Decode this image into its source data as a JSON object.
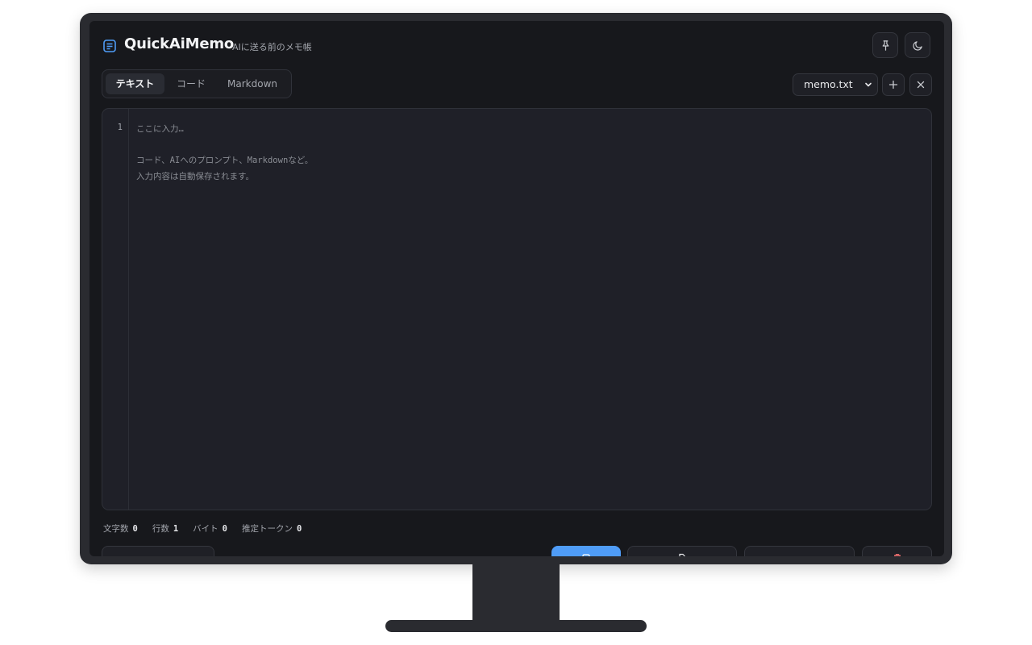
{
  "app": {
    "title": "QuickAiMemo",
    "subtitle": "AIに送る前のメモ帳"
  },
  "tabs": [
    {
      "label": "テキスト",
      "active": true
    },
    {
      "label": "コード",
      "active": false
    },
    {
      "label": "Markdown",
      "active": false
    }
  ],
  "file": {
    "selected": "memo.txt"
  },
  "editor": {
    "line_number": "1",
    "placeholder": "ここに入力…\n\nコード、AIへのプロンプト、Markdownなど。\n入力内容は自動保存されます。"
  },
  "stats": [
    {
      "label": "文字数",
      "value": "0"
    },
    {
      "label": "行数",
      "value": "1"
    },
    {
      "label": "バイト",
      "value": "0"
    },
    {
      "label": "推定トークン",
      "value": "0"
    }
  ],
  "colors": {
    "accent": "#4f9cf7",
    "background": "#17181c",
    "editor_bg": "#1f2028",
    "danger": "#f07070"
  },
  "icons": {
    "app": "memo-icon",
    "pin": "pin-icon",
    "theme": "moon-icon",
    "add": "plus-icon",
    "close": "close-icon"
  }
}
